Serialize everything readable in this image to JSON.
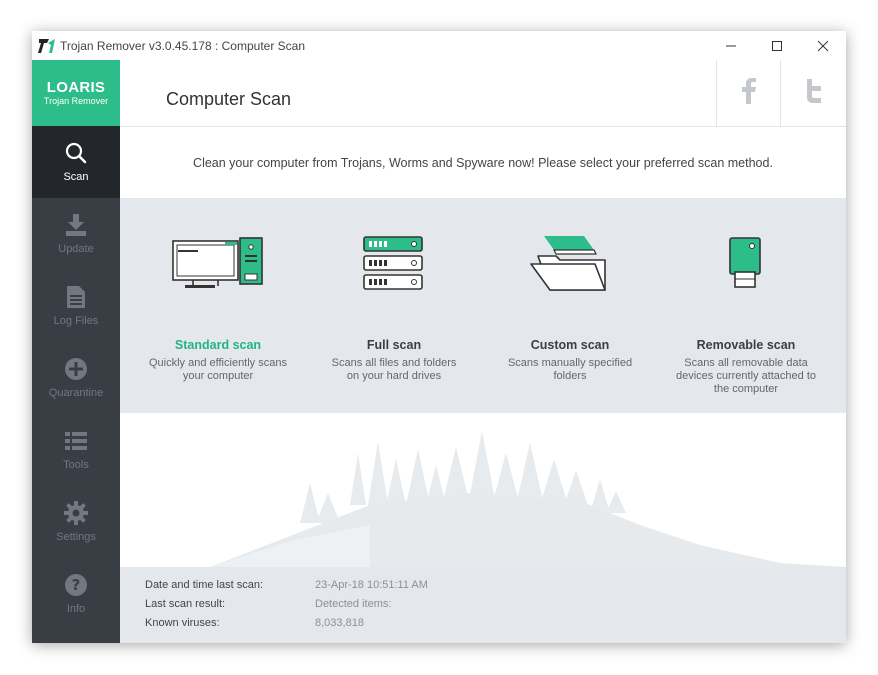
{
  "window": {
    "title": "Trojan Remover v3.0.45.178 : Computer Scan",
    "controls": {
      "minimize": "—",
      "maximize": "☐",
      "close": "✕"
    }
  },
  "brand": {
    "name": "LOARIS",
    "product": "Trojan Remover",
    "color": "#2dbd8a"
  },
  "sidebar": {
    "items": [
      {
        "label": "Scan",
        "icon": "search-icon",
        "active": true
      },
      {
        "label": "Update",
        "icon": "download-icon",
        "active": false
      },
      {
        "label": "Log Files",
        "icon": "document-icon",
        "active": false
      },
      {
        "label": "Quarantine",
        "icon": "plus-circle-icon",
        "active": false
      },
      {
        "label": "Tools",
        "icon": "list-icon",
        "active": false
      },
      {
        "label": "Settings",
        "icon": "gear-icon",
        "active": false
      },
      {
        "label": "Info",
        "icon": "question-icon",
        "active": false
      }
    ]
  },
  "header": {
    "title": "Computer Scan",
    "social": [
      "facebook-icon",
      "twitter-icon"
    ]
  },
  "subtitle": "Clean your computer from Trojans, Worms and Spyware now! Please select your preferred scan method.",
  "scan_options": [
    {
      "name": "Standard scan",
      "desc_line1": "Quickly and efficiently scans",
      "desc_line2": "your computer",
      "desc_line3": "",
      "icon": "computer-icon",
      "selected": true
    },
    {
      "name": "Full scan",
      "desc_line1": "Scans all files and folders",
      "desc_line2": "on your hard drives",
      "desc_line3": "",
      "icon": "server-icon",
      "selected": false
    },
    {
      "name": "Custom scan",
      "desc_line1": "Scans manually specified",
      "desc_line2": "folders",
      "desc_line3": "",
      "icon": "folder-icon",
      "selected": false
    },
    {
      "name": "Removable scan",
      "desc_line1": "Scans all removable data",
      "desc_line2": "devices currently attached to",
      "desc_line3": "the computer",
      "icon": "usb-drive-icon",
      "selected": false
    }
  ],
  "info": {
    "last_scan_label": "Date and time last scan:",
    "last_scan_value": "23-Apr-18 10:51:11 AM",
    "result_label": "Last scan result:",
    "result_value": "Detected items:",
    "viruses_label": "Known viruses:",
    "viruses_value": "8,033,818"
  },
  "colors": {
    "accent": "#22b581",
    "sidebar": "#393e45",
    "sidebar_active": "#23272c",
    "panel": "#e4e8ec"
  }
}
